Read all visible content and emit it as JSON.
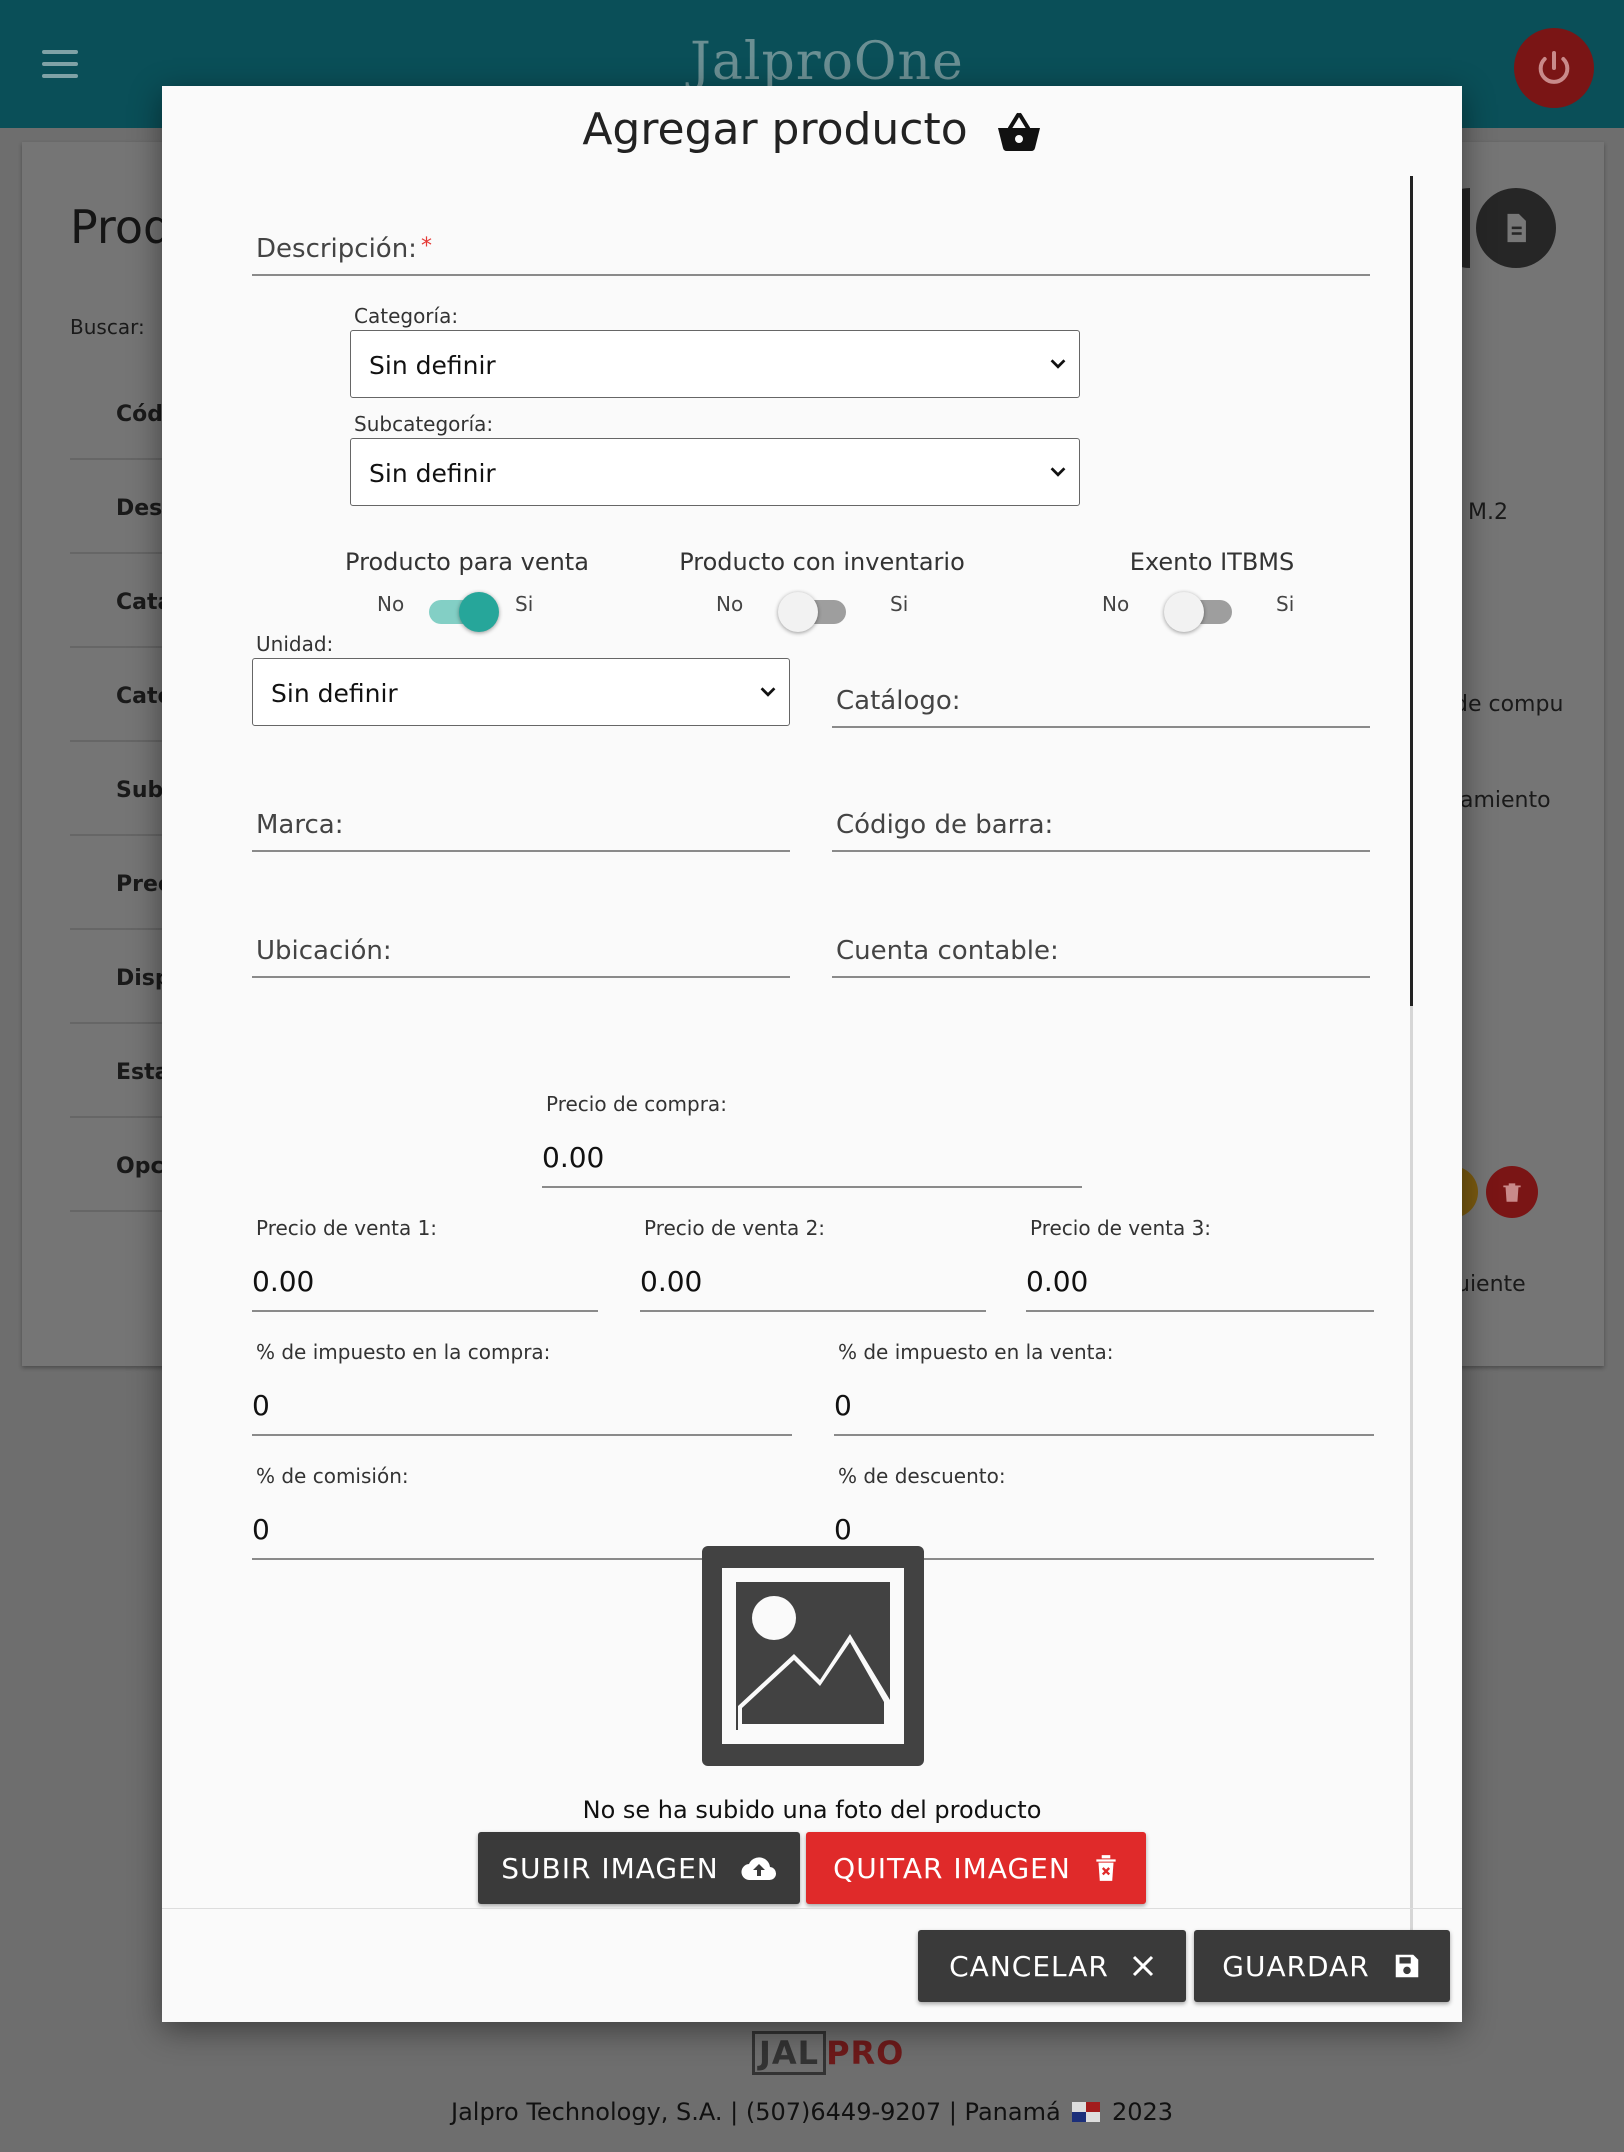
{
  "app": {
    "brand": "JalproOne"
  },
  "background": {
    "page_title_partial": "Prod",
    "search_label": "Buscar:",
    "table_headers_partial": [
      "Códi",
      "Desc",
      "Catá",
      "Cate",
      "Subc",
      "Preci",
      "Disp",
      "Esta",
      "Opci"
    ],
    "right_fragments": [
      "M.2",
      "de compu",
      "amiento",
      "uiente"
    ]
  },
  "modal": {
    "title": "Agregar producto",
    "description": {
      "label": "Descripción:",
      "required_mark": "*"
    },
    "categoria": {
      "label": "Categoría:",
      "value": "Sin definir"
    },
    "subcategoria": {
      "label": "Subcategoría:",
      "value": "Sin definir"
    },
    "toggles": [
      {
        "title": "Producto para venta",
        "no": "No",
        "si": "Si",
        "on": true
      },
      {
        "title": "Producto con inventario",
        "no": "No",
        "si": "Si",
        "on": false
      },
      {
        "title": "Exento ITBMS",
        "no": "No",
        "si": "Si",
        "on": false
      }
    ],
    "unidad": {
      "label": "Unidad:",
      "value": "Sin definir"
    },
    "catalogo": {
      "label": "Catálogo:"
    },
    "marca": {
      "label": "Marca:"
    },
    "codigo_barra": {
      "label": "Código de barra:"
    },
    "ubicacion": {
      "label": "Ubicación:"
    },
    "cuenta_contable": {
      "label": "Cuenta contable:"
    },
    "precio_compra": {
      "label": "Precio de compra:",
      "value": "0.00"
    },
    "precio_venta_1": {
      "label": "Precio de venta 1:",
      "value": "0.00"
    },
    "precio_venta_2": {
      "label": "Precio de venta 2:",
      "value": "0.00"
    },
    "precio_venta_3": {
      "label": "Precio de venta 3:",
      "value": "0.00"
    },
    "impuesto_compra": {
      "label": "% de impuesto en la compra:",
      "value": "0"
    },
    "impuesto_venta": {
      "label": "% de impuesto en la venta:",
      "value": "0"
    },
    "comision": {
      "label": "% de comisión:",
      "value": "0"
    },
    "descuento": {
      "label": "% de descuento:",
      "value": "0"
    },
    "no_photo_text": "No se ha subido una foto del producto",
    "upload_button": "SUBIR IMAGEN",
    "remove_button": "QUITAR IMAGEN",
    "cancel_button": "CANCELAR",
    "save_button": "GUARDAR"
  },
  "footer": {
    "logo_jal": "JAL",
    "logo_pro": "PRO",
    "company": "Jalpro Technology, S.A. | (507)6449-9207 | Panamá",
    "year": "2023"
  },
  "colors": {
    "header_teal": "#0a4f58",
    "toggle_on": "#26a69a",
    "danger_red": "#e02a2a",
    "dark_button": "#3a3a3a"
  }
}
